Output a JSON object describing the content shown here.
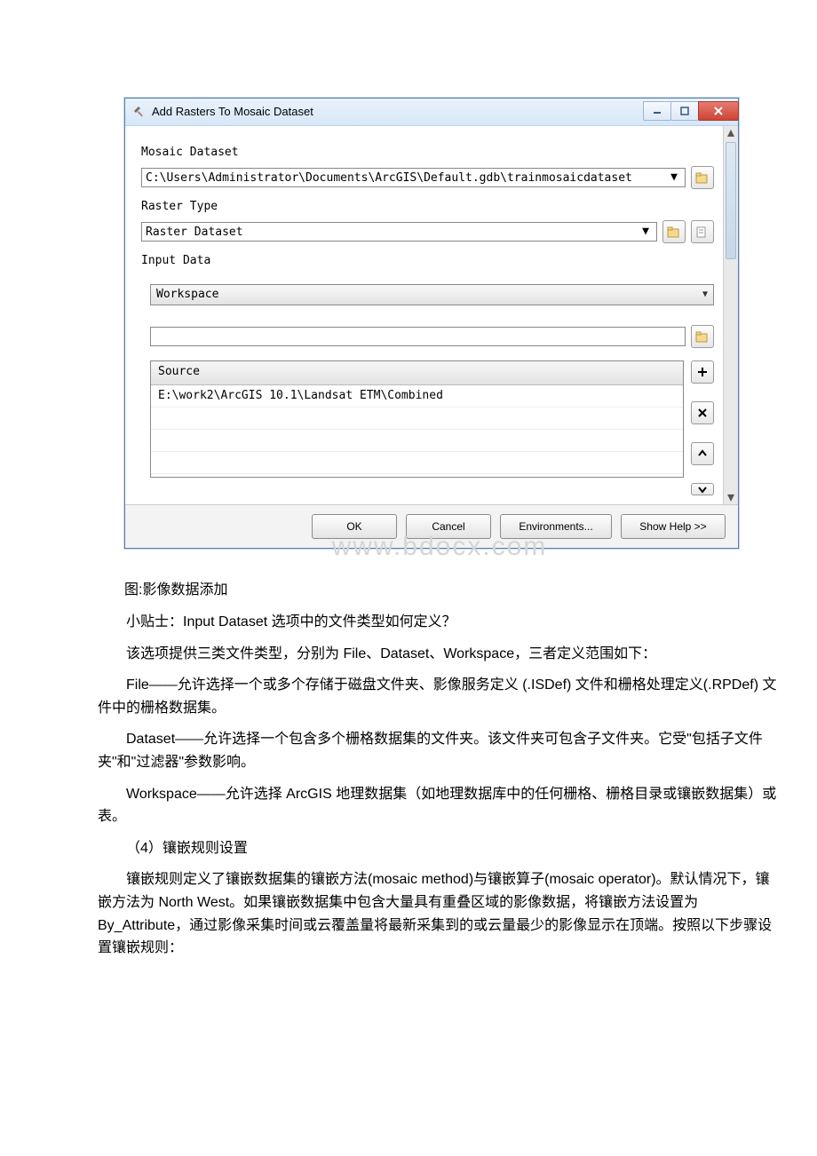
{
  "dialog": {
    "title": "Add Rasters To Mosaic Dataset",
    "mosaic_dataset_label": "Mosaic Dataset",
    "mosaic_dataset_value": "C:\\Users\\Administrator\\Documents\\ArcGIS\\Default.gdb\\trainmosaicdataset",
    "raster_type_label": "Raster Type",
    "raster_type_value": "Raster Dataset",
    "input_data_label": "Input Data",
    "input_data_type": "Workspace",
    "source_header": "Source",
    "source_rows": [
      "E:\\work2\\ArcGIS 10.1\\Landsat ETM\\Combined"
    ],
    "buttons": {
      "ok": "OK",
      "cancel": "Cancel",
      "env": "Environments...",
      "help": "Show Help >>"
    }
  },
  "doc": {
    "caption": "图:影像数据添加",
    "p1": "小贴士：Input Dataset 选项中的文件类型如何定义？",
    "p2": "该选项提供三类文件类型，分别为 File、Dataset、Workspace，三者定义范围如下：",
    "p3": "File——允许选择一个或多个存储于磁盘文件夹、影像服务定义 (.ISDef) 文件和栅格处理定义(.RPDef) 文件中的栅格数据集。",
    "p4": "Dataset——允许选择一个包含多个栅格数据集的文件夹。该文件夹可包含子文件夹。它受\"包括子文件夹\"和\"过滤器\"参数影响。",
    "p5": "Workspace——允许选择 ArcGIS 地理数据集（如地理数据库中的任何栅格、栅格目录或镶嵌数据集）或表。",
    "p6": "（4）镶嵌规则设置",
    "p7": "镶嵌规则定义了镶嵌数据集的镶嵌方法(mosaic method)与镶嵌算子(mosaic operator)。默认情况下，镶嵌方法为 North West。如果镶嵌数据集中包含大量具有重叠区域的影像数据，将镶嵌方法设置为 By_Attribute，通过影像采集时间或云覆盖量将最新采集到的或云量最少的影像显示在顶端。按照以下步骤设置镶嵌规则："
  },
  "watermark": "www.bdocx.com"
}
